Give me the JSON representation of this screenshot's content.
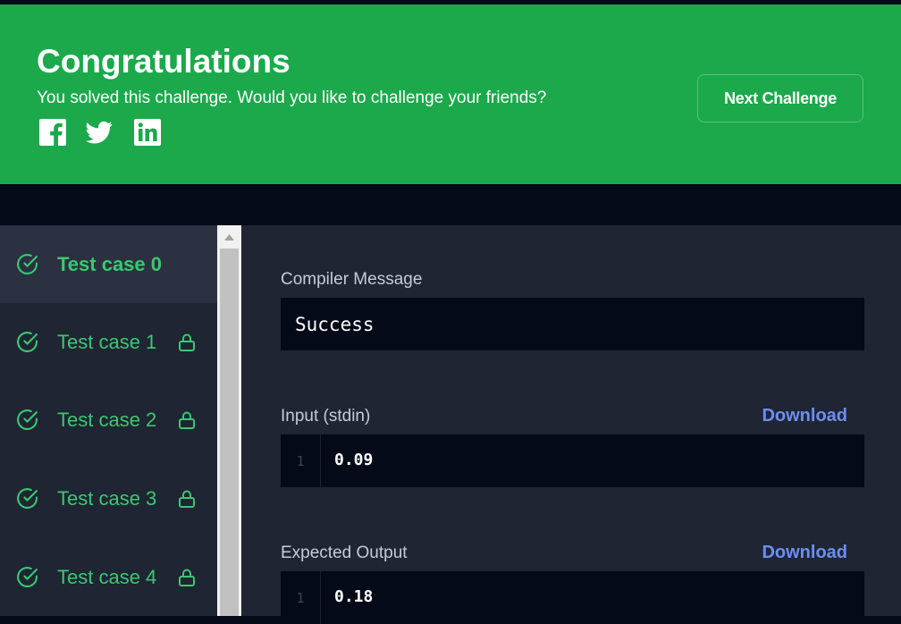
{
  "banner": {
    "title": "Congratulations",
    "subtitle": "You solved this challenge. Would you like to challenge your friends?",
    "social": [
      "facebook-icon",
      "twitter-icon",
      "linkedin-icon"
    ],
    "next_button": "Next Challenge",
    "color": "#1ba94c"
  },
  "test_cases": [
    {
      "label": "Test case 0",
      "status": "passed",
      "locked": false,
      "active": true
    },
    {
      "label": "Test case 1",
      "status": "passed",
      "locked": true,
      "active": false
    },
    {
      "label": "Test case 2",
      "status": "passed",
      "locked": true,
      "active": false
    },
    {
      "label": "Test case 3",
      "status": "passed",
      "locked": true,
      "active": false
    },
    {
      "label": "Test case 4",
      "status": "passed",
      "locked": true,
      "active": false
    }
  ],
  "compiler": {
    "label": "Compiler Message",
    "message": "Success"
  },
  "input": {
    "label": "Input (stdin)",
    "download": "Download",
    "line_number": "1",
    "value": "0.09"
  },
  "expected": {
    "label": "Expected Output",
    "download": "Download",
    "line_number": "1",
    "value": "0.18"
  },
  "colors": {
    "pass_green": "#39c970",
    "link_blue": "#6d8ef2",
    "panel": "#1f2533",
    "code_bg": "#050a18"
  }
}
